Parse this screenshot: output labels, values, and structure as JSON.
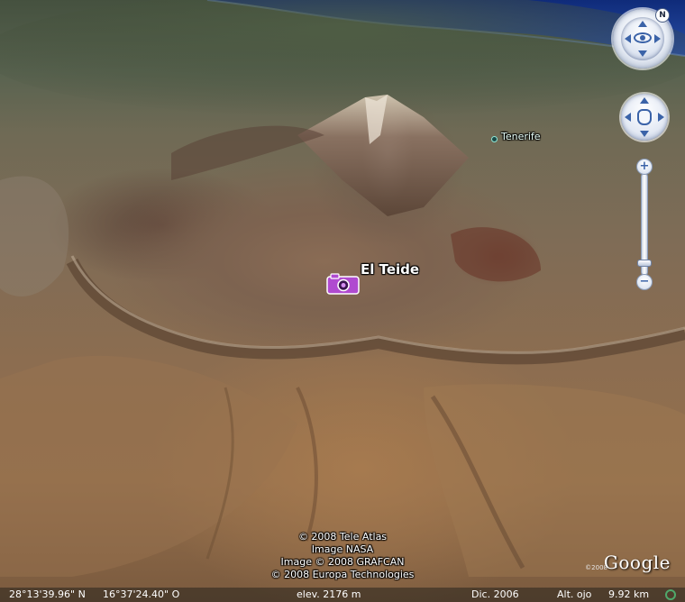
{
  "map": {
    "placemarks": {
      "peak_label": "El Teide",
      "peak_icon": "camera-icon",
      "town_label": "Tenerife"
    },
    "colors": {
      "sea": "#1e3a8a",
      "photo_icon": "#b04ad0",
      "control_accent": "#3b63a8"
    }
  },
  "navigation": {
    "north_label": "N",
    "look_icon": "eye-icon",
    "move_icon": "hand-icon",
    "zoom_in_label": "+",
    "zoom_out_label": "−",
    "zoom_level": 0.92
  },
  "attribution": {
    "lines": [
      "© 2008 Tele Atlas",
      "Image NASA",
      "Image © 2008 GRAFCAN",
      "© 2008 Europa Technologies"
    ]
  },
  "logo": {
    "text": "Google",
    "year": "©2008"
  },
  "status_bar": {
    "latitude": "28°13'39.96\" N",
    "longitude": "16°37'24.40\" O",
    "elevation": "elev. 2176 m",
    "imagery_date": "Dic. 2006",
    "eye_alt_label": "Alt. ojo",
    "eye_alt_value": "9.92 km",
    "streaming_icon": "streaming-indicator-icon"
  }
}
